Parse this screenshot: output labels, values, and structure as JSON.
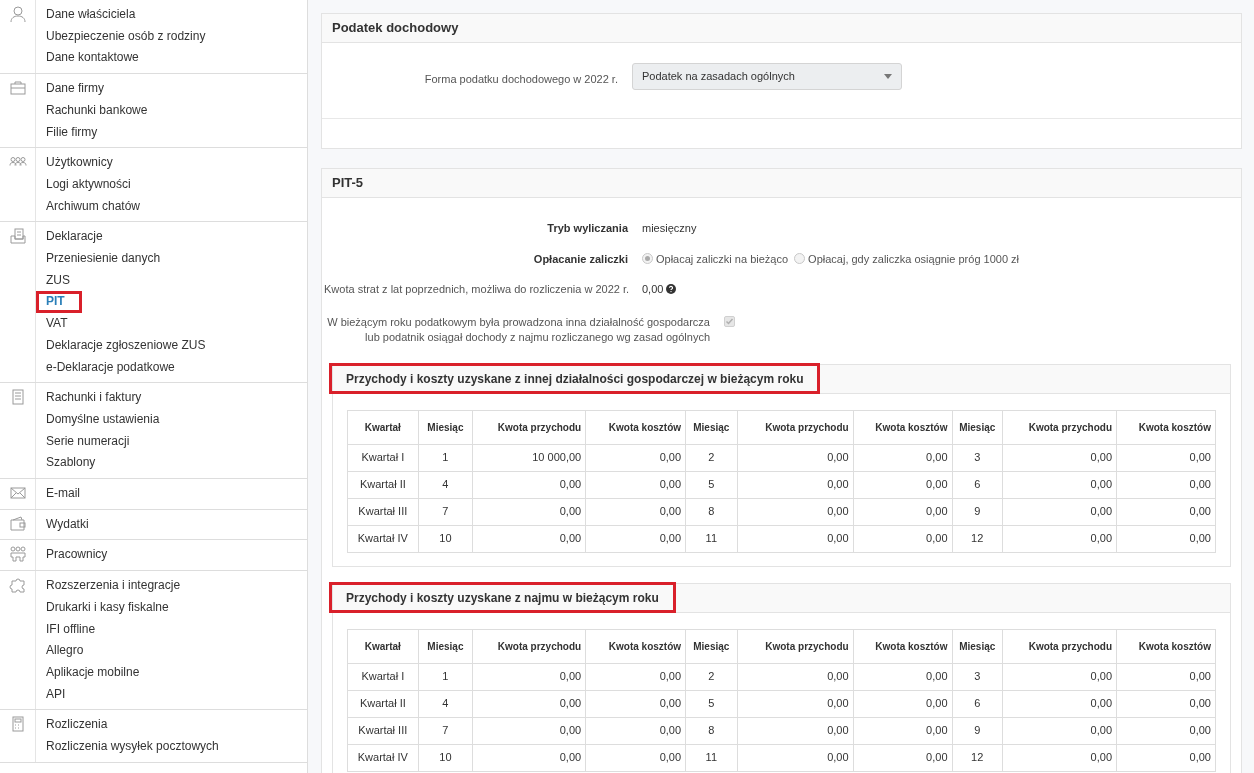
{
  "sidebar": {
    "groups": [
      {
        "items": [
          {
            "label": "Dane właściciela",
            "selected": false,
            "highlighted": false
          },
          {
            "label": "Ubezpieczenie osób z rodziny",
            "selected": false,
            "highlighted": false
          },
          {
            "label": "Dane kontaktowe",
            "selected": false,
            "highlighted": false
          }
        ]
      },
      {
        "items": [
          {
            "label": "Dane firmy",
            "selected": false,
            "highlighted": false
          },
          {
            "label": "Rachunki bankowe",
            "selected": false,
            "highlighted": false
          },
          {
            "label": "Filie firmy",
            "selected": false,
            "highlighted": false
          }
        ]
      },
      {
        "items": [
          {
            "label": "Użytkownicy",
            "selected": false,
            "highlighted": false
          },
          {
            "label": "Logi aktywności",
            "selected": false,
            "highlighted": false
          },
          {
            "label": "Archiwum chatów",
            "selected": false,
            "highlighted": false
          }
        ]
      },
      {
        "items": [
          {
            "label": "Deklaracje",
            "selected": false,
            "highlighted": false
          },
          {
            "label": "Przeniesienie danych",
            "selected": false,
            "highlighted": false
          },
          {
            "label": "ZUS",
            "selected": false,
            "highlighted": false
          },
          {
            "label": "PIT",
            "selected": true,
            "highlighted": true
          },
          {
            "label": "VAT",
            "selected": false,
            "highlighted": false
          },
          {
            "label": "Deklaracje zgłoszeniowe ZUS",
            "selected": false,
            "highlighted": false
          },
          {
            "label": "e-Deklaracje podatkowe",
            "selected": false,
            "highlighted": false
          }
        ]
      },
      {
        "items": [
          {
            "label": "Rachunki i faktury",
            "selected": false,
            "highlighted": false
          },
          {
            "label": "Domyślne ustawienia",
            "selected": false,
            "highlighted": false
          },
          {
            "label": "Serie numeracji",
            "selected": false,
            "highlighted": false
          },
          {
            "label": "Szablony",
            "selected": false,
            "highlighted": false
          }
        ]
      },
      {
        "items": [
          {
            "label": "E-mail",
            "selected": false,
            "highlighted": false
          }
        ]
      },
      {
        "items": [
          {
            "label": "Wydatki",
            "selected": false,
            "highlighted": false
          }
        ]
      },
      {
        "items": [
          {
            "label": "Pracownicy",
            "selected": false,
            "highlighted": false
          }
        ]
      },
      {
        "items": [
          {
            "label": "Rozszerzenia i integracje",
            "selected": false,
            "highlighted": false
          },
          {
            "label": "Drukarki i kasy fiskalne",
            "selected": false,
            "highlighted": false
          },
          {
            "label": "IFI offline",
            "selected": false,
            "highlighted": false
          },
          {
            "label": "Allegro",
            "selected": false,
            "highlighted": false
          },
          {
            "label": "Aplikacje mobilne",
            "selected": false,
            "highlighted": false
          },
          {
            "label": "API",
            "selected": false,
            "highlighted": false
          }
        ]
      },
      {
        "items": [
          {
            "label": "Rozliczenia",
            "selected": false,
            "highlighted": false
          },
          {
            "label": "Rozliczenia wysyłek pocztowych",
            "selected": false,
            "highlighted": false
          }
        ]
      }
    ]
  },
  "income_tax_panel": {
    "title": "Podatek dochodowy",
    "field": {
      "label": "Forma podatku dochodowego w 2022 r.",
      "value": "Podatek na zasadach ogólnych"
    }
  },
  "pit5_panel": {
    "title": "PIT-5",
    "calculation_mode": {
      "label": "Tryb wyliczania",
      "value": "miesięczny"
    },
    "advance_payment": {
      "label": "Opłacanie zaliczki",
      "options": [
        {
          "label": "Opłacaj zaliczki na bieżąco",
          "selected": true
        },
        {
          "label": "Opłacaj, gdy zaliczka osiągnie próg 1000 zł",
          "selected": false
        }
      ]
    },
    "losses": {
      "label": "Kwota strat z lat poprzednich, możliwa do rozliczenia w 2022 r.",
      "value": "0,00"
    },
    "other_activity": {
      "lines": [
        "W bieżącym roku podatkowym była prowadzona inna działalność gospodarcza",
        "lub podatnik osiągał dochody z najmu rozliczanego wg zasad ogólnych"
      ],
      "checked": true,
      "disabled": true
    },
    "sections": [
      {
        "title": "Przychody i koszty uzyskane z innej działalności gospodarczej w bieżącym roku",
        "highlighted": true,
        "columns": [
          "Kwartał",
          "Miesiąc",
          "Kwota przychodu",
          "Kwota kosztów",
          "Miesiąc",
          "Kwota przychodu",
          "Kwota kosztów",
          "Miesiąc",
          "Kwota przychodu",
          "Kwota kosztów"
        ],
        "rows": [
          [
            "Kwartał I",
            "1",
            "10 000,00",
            "0,00",
            "2",
            "0,00",
            "0,00",
            "3",
            "0,00",
            "0,00"
          ],
          [
            "Kwartał II",
            "4",
            "0,00",
            "0,00",
            "5",
            "0,00",
            "0,00",
            "6",
            "0,00",
            "0,00"
          ],
          [
            "Kwartał III",
            "7",
            "0,00",
            "0,00",
            "8",
            "0,00",
            "0,00",
            "9",
            "0,00",
            "0,00"
          ],
          [
            "Kwartał IV",
            "10",
            "0,00",
            "0,00",
            "11",
            "0,00",
            "0,00",
            "12",
            "0,00",
            "0,00"
          ]
        ]
      },
      {
        "title": "Przychody i koszty uzyskane z najmu w bieżącym roku",
        "highlighted": true,
        "columns": [
          "Kwartał",
          "Miesiąc",
          "Kwota przychodu",
          "Kwota kosztów",
          "Miesiąc",
          "Kwota przychodu",
          "Kwota kosztów",
          "Miesiąc",
          "Kwota przychodu",
          "Kwota kosztów"
        ],
        "rows": [
          [
            "Kwartał I",
            "1",
            "0,00",
            "0,00",
            "2",
            "0,00",
            "0,00",
            "3",
            "0,00",
            "0,00"
          ],
          [
            "Kwartał II",
            "4",
            "0,00",
            "0,00",
            "5",
            "0,00",
            "0,00",
            "6",
            "0,00",
            "0,00"
          ],
          [
            "Kwartał III",
            "7",
            "0,00",
            "0,00",
            "8",
            "0,00",
            "0,00",
            "9",
            "0,00",
            "0,00"
          ],
          [
            "Kwartał IV",
            "10",
            "0,00",
            "0,00",
            "11",
            "0,00",
            "0,00",
            "12",
            "0,00",
            "0,00"
          ]
        ]
      }
    ]
  }
}
